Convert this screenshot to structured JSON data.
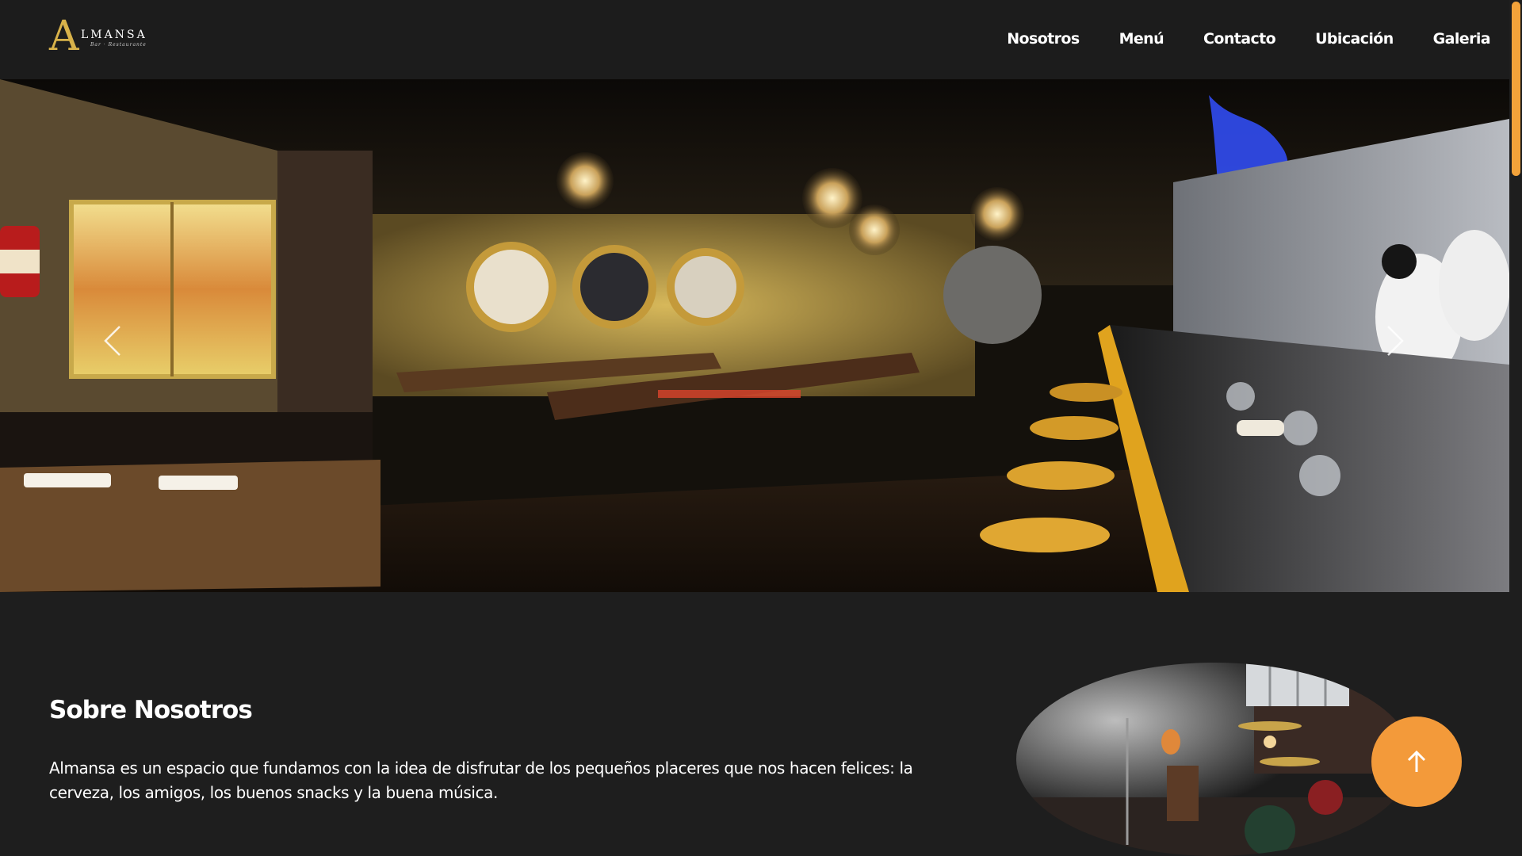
{
  "brand": {
    "logo_letter": "A",
    "logo_word": "LMANSA",
    "logo_sub": "Bar · Restaurante",
    "accent_color": "#d8b24a"
  },
  "nav": {
    "items": [
      {
        "label": "Nosotros"
      },
      {
        "label": "Menú"
      },
      {
        "label": "Contacto"
      },
      {
        "label": "Ubicación"
      },
      {
        "label": "Galeria"
      }
    ]
  },
  "hero": {
    "image": "restaurant-bar-interior-photo",
    "prev_icon": "chevron-left-icon",
    "next_icon": "chevron-right-icon"
  },
  "about": {
    "title": "Sobre Nosotros",
    "text": "Almansa es un espacio que fundamos con la idea de disfrutar de los pequeños placeres que nos hacen felices: la cerveza, los amigos, los buenos snacks y la buena música.",
    "image": "live-music-stage-photo"
  },
  "back_to_top": {
    "icon": "arrow-up-icon",
    "color": "#f39a3a"
  },
  "scrollbar": {
    "thumb_color": "#f2a23a"
  }
}
